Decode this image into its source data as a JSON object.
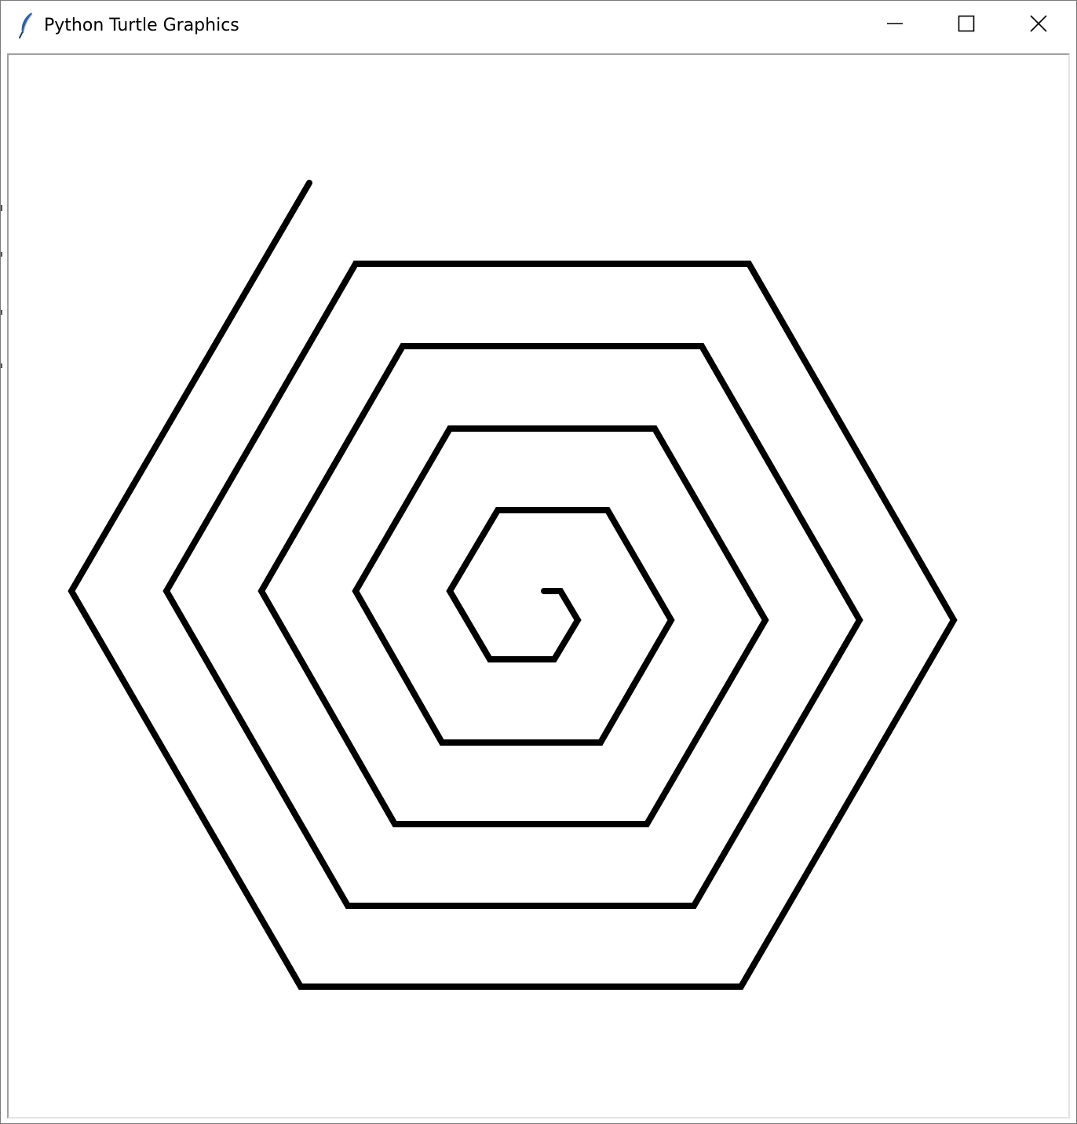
{
  "window": {
    "title": "Python Turtle Graphics",
    "app_icon": "feather-icon",
    "controls": {
      "minimize": "minimize-icon",
      "maximize": "maximize-icon",
      "close": "close-icon"
    }
  },
  "canvas": {
    "background": "#ffffff",
    "pen_color": "#000000",
    "drawing": "hexagonal-spiral"
  }
}
